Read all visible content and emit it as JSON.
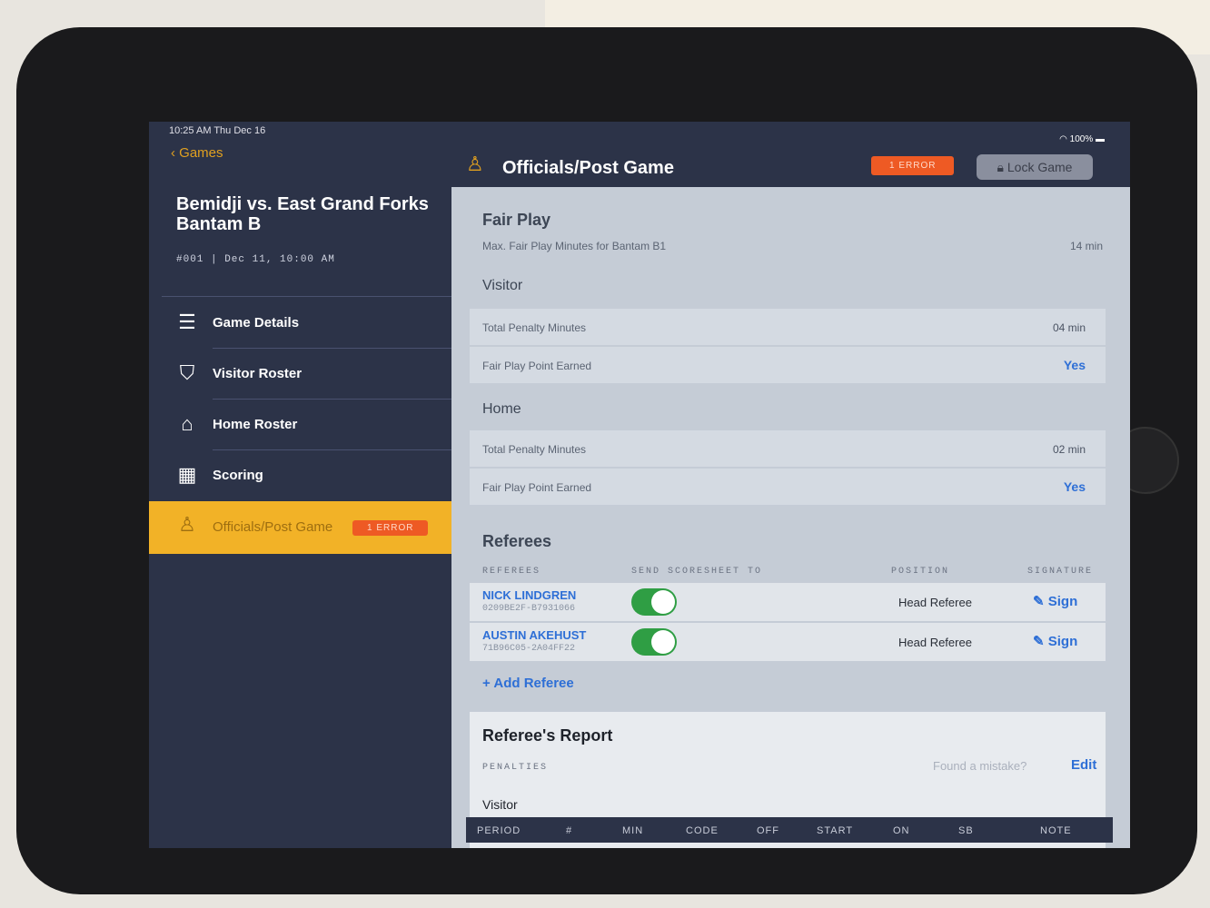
{
  "status": {
    "time_date": "10:25 AM   Thu Dec 16",
    "battery": "100%"
  },
  "nav": {
    "back_label": "Games"
  },
  "game": {
    "title": "Bemidji vs. East Grand Forks Bantam B",
    "meta": "#001   |   Dec 11, 10:00 AM"
  },
  "sidebar": {
    "items": [
      {
        "label": "Game Details",
        "icon": "document-icon"
      },
      {
        "label": "Visitor Roster",
        "icon": "jersey-icon"
      },
      {
        "label": "Home Roster",
        "icon": "home-icon"
      },
      {
        "label": "Scoring",
        "icon": "scoreboard-icon"
      },
      {
        "label": "Officials/Post Game",
        "icon": "referee-icon",
        "badge": "1 ERROR",
        "active": true
      }
    ]
  },
  "header": {
    "title": "Officials/Post Game",
    "error_badge": "1 ERROR",
    "lock_label": "Lock Game"
  },
  "fair_play": {
    "title": "Fair Play",
    "max_label": "Max. Fair Play Minutes for Bantam B1",
    "max_value": "14 min",
    "visitor": {
      "title": "Visitor",
      "penalty_label": "Total Penalty Minutes",
      "penalty_value": "04 min",
      "point_label": "Fair Play Point Earned",
      "point_value": "Yes"
    },
    "home": {
      "title": "Home",
      "penalty_label": "Total Penalty Minutes",
      "penalty_value": "02 min",
      "point_label": "Fair Play Point Earned",
      "point_value": "Yes"
    }
  },
  "referees": {
    "title": "Referees",
    "col_referees": "REFEREES",
    "col_send": "SEND SCORESHEET TO",
    "col_position": "POSITION",
    "col_signature": "SIGNATURE",
    "rows": [
      {
        "name": "NICK LINDGREN",
        "id": "0209BE2F-B7931066",
        "position": "Head Referee",
        "sign": "Sign",
        "send": true
      },
      {
        "name": "AUSTIN AKEHUST",
        "id": "71B96C05-2A04FF22",
        "position": "Head Referee",
        "sign": "Sign",
        "send": true
      }
    ],
    "add_label": "Add Referee"
  },
  "report": {
    "title": "Referee's Report",
    "penalties_label": "PENALTIES",
    "mistake_text": "Found a mistake?",
    "edit_label": "Edit",
    "visitor_label": "Visitor",
    "columns": [
      "PERIOD",
      "#",
      "MIN",
      "CODE",
      "OFF",
      "START",
      "ON",
      "SB",
      "NOTE"
    ]
  },
  "colors": {
    "accent": "#f2b227",
    "error": "#ee5a24",
    "link": "#2e6fd6",
    "sidebar": "#2c3348"
  }
}
